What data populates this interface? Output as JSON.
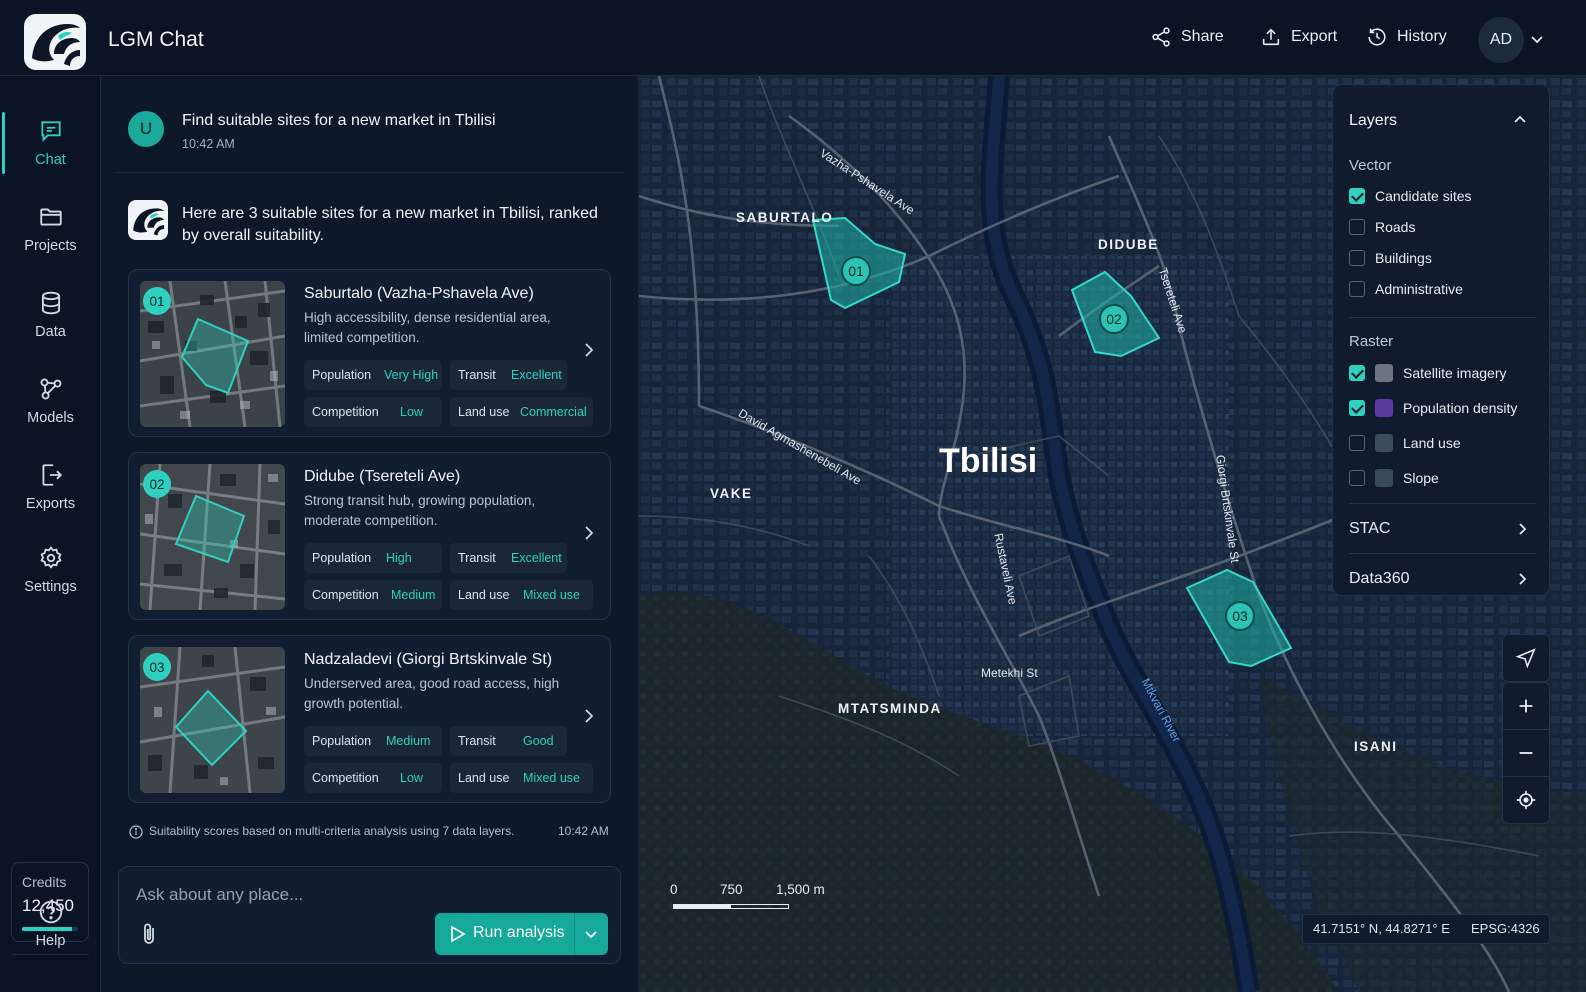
{
  "app": {
    "title": "LGM Chat",
    "accent_color": "#2fd0bf"
  },
  "header": {
    "share_label": "Share",
    "export_label": "Export",
    "history_label": "History",
    "user_initials": "AD"
  },
  "nav": {
    "items": [
      {
        "label": "Chat",
        "icon": "chat-icon",
        "active": true
      },
      {
        "label": "Projects",
        "icon": "folder-icon"
      },
      {
        "label": "Data",
        "icon": "database-icon"
      },
      {
        "label": "Models",
        "icon": "models-icon"
      },
      {
        "label": "Exports",
        "icon": "export-file-icon"
      },
      {
        "label": "Settings",
        "icon": "gear-icon"
      }
    ],
    "credits_label": "Credits",
    "credits_value": "12,450",
    "credits_fraction": 0.9,
    "help_label": "Help"
  },
  "chat": {
    "user_initial": "U",
    "user_message": "Find suitable sites for a new market in Tbilisi",
    "user_time": "10:42 AM",
    "bot_message": "Here are 3 suitable sites for a new market in Tbilisi, ranked by overall suitability.",
    "sites": [
      {
        "rank": "01",
        "title": "Saburtalo (Vazha-Pshavela Ave)",
        "description": "High accessibility, dense residential area, limited competition.",
        "population_label": "Population",
        "population_value": "Very High",
        "transit_label": "Transit",
        "transit_value": "Excellent",
        "competition_label": "Competition",
        "competition_value": "Low",
        "landuse_label": "Land use",
        "landuse_value": "Commercial"
      },
      {
        "rank": "02",
        "title": "Didube (Tsereteli Ave)",
        "description": "Strong transit hub, growing population, moderate competition.",
        "population_label": "Population",
        "population_value": "High",
        "transit_label": "Transit",
        "transit_value": "Excellent",
        "competition_label": "Competition",
        "competition_value": "Medium",
        "landuse_label": "Land use",
        "landuse_value": "Mixed use"
      },
      {
        "rank": "03",
        "title": "Nadzaladevi (Giorgi Brtskinvale St)",
        "description": "Underserved area, good road access, high growth potential.",
        "population_label": "Population",
        "population_value": "Medium",
        "transit_label": "Transit",
        "transit_value": "Good",
        "competition_label": "Competition",
        "competition_value": "Low",
        "landuse_label": "Land use",
        "landuse_value": "Mixed use"
      }
    ],
    "footnote": "Suitability scores based on multi-criteria analysis using 7 data layers.",
    "footnote_time": "10:42 AM",
    "composer_placeholder": "Ask about any place...",
    "run_label": "Run analysis"
  },
  "layers": {
    "title": "Layers",
    "vector_label": "Vector",
    "vector": [
      {
        "label": "Candidate sites",
        "checked": true
      },
      {
        "label": "Roads",
        "checked": false
      },
      {
        "label": "Buildings",
        "checked": false
      },
      {
        "label": "Administrative",
        "checked": false
      }
    ],
    "raster_label": "Raster",
    "raster": [
      {
        "label": "Satellite imagery",
        "checked": true,
        "swatch": "#6b7480"
      },
      {
        "label": "Population density",
        "checked": true,
        "swatch": "#5b3a9e"
      },
      {
        "label": "Land use",
        "checked": false,
        "swatch": "#3d4c5c"
      },
      {
        "label": "Slope",
        "checked": false,
        "swatch": "#3a4a58"
      }
    ],
    "stac_label": "STAC",
    "data360_label": "Data360"
  },
  "map": {
    "city": "Tbilisi",
    "districts": [
      "SABURTALO",
      "DIDUBE",
      "VAKE",
      "MTATSMINDA",
      "ISANI"
    ],
    "streets": [
      "Vazha-Pshavela Ave",
      "Tsereteli Ave",
      "David Agmashenebeli Ave",
      "Rustaveli Ave",
      "Giorgi Brtskinvale St",
      "Metekhi St"
    ],
    "river": "Mtkvari River",
    "markers": [
      "01",
      "02",
      "03"
    ],
    "scale": {
      "t0": "0",
      "t1": "750",
      "t2": "1,500 m"
    },
    "coordinates": "41.7151° N, 44.8271° E",
    "crs": "EPSG:4326"
  }
}
